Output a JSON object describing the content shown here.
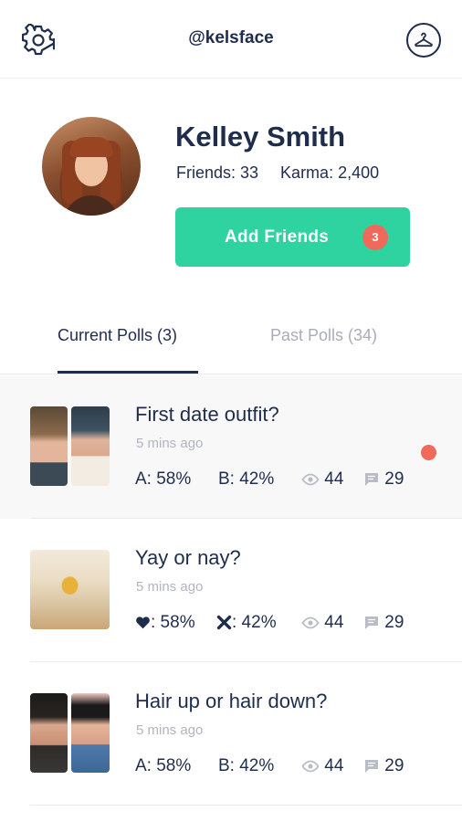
{
  "header": {
    "username": "@kelsface",
    "left_icon": "gear-icon",
    "right_icon": "hanger-icon"
  },
  "profile": {
    "name": "Kelley Smith",
    "friends_text": "Friends: 33",
    "karma_text": "Karma: 2,400",
    "add_friends_label": "Add Friends",
    "add_friends_badge": "3"
  },
  "tabs": {
    "current": "Current Polls (3)",
    "past": "Past Polls (34)",
    "selected": "current"
  },
  "polls": [
    {
      "title": "First date outfit?",
      "time": "5 mins ago",
      "a": "A: 58%",
      "b": "B: 42%",
      "views": "44",
      "comments": "29",
      "unread": true,
      "vote_style": "ab"
    },
    {
      "title": "Yay or nay?",
      "time": "5 mins ago",
      "a": ": 58%",
      "b": ": 42%",
      "views": "44",
      "comments": "29",
      "unread": false,
      "vote_style": "heart-x"
    },
    {
      "title": "Hair up or hair down?",
      "time": "5 mins ago",
      "a": "A: 58%",
      "b": "B: 42%",
      "views": "44",
      "comments": "29",
      "unread": false,
      "vote_style": "ab"
    }
  ],
  "colors": {
    "navy": "#1f2d4d",
    "green": "#2fd39f",
    "red": "#ef6a5a",
    "muted": "#b1b5bf"
  }
}
